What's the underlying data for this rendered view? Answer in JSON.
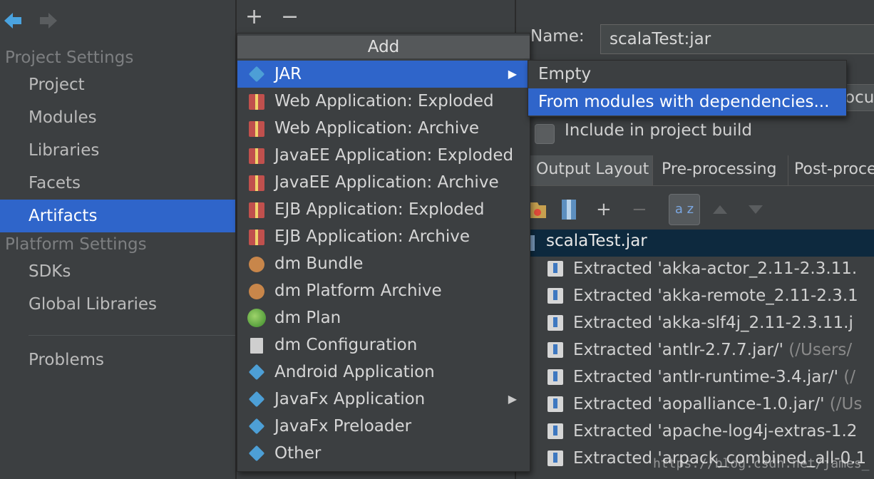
{
  "sidebar": {
    "project_settings_title": "Project Settings",
    "platform_settings_title": "Platform Settings",
    "project_items": [
      "Project",
      "Modules",
      "Libraries",
      "Facets",
      "Artifacts"
    ],
    "platform_items": [
      "SDKs",
      "Global Libraries"
    ],
    "problems": "Problems",
    "selected": "Artifacts"
  },
  "toolbar": {
    "add": "+",
    "remove": "−"
  },
  "add_menu": {
    "title": "Add",
    "items": [
      {
        "label": "JAR",
        "icon": "jar-diamond-icon",
        "submenu": true
      },
      {
        "label": "Web Application: Exploded",
        "icon": "gift-icon"
      },
      {
        "label": "Web Application: Archive",
        "icon": "gift-icon"
      },
      {
        "label": "JavaEE Application: Exploded",
        "icon": "gift-icon"
      },
      {
        "label": "JavaEE Application: Archive",
        "icon": "gift-icon"
      },
      {
        "label": "EJB Application: Exploded",
        "icon": "gift-icon"
      },
      {
        "label": "EJB Application: Archive",
        "icon": "gift-icon"
      },
      {
        "label": "dm Bundle",
        "icon": "bundle-icon"
      },
      {
        "label": "dm Platform Archive",
        "icon": "bundle-icon"
      },
      {
        "label": "dm Plan",
        "icon": "globe-icon"
      },
      {
        "label": "dm Configuration",
        "icon": "document-icon"
      },
      {
        "label": "Android Application",
        "icon": "diamond-icon"
      },
      {
        "label": "JavaFx Application",
        "icon": "diamond-icon",
        "submenu": true
      },
      {
        "label": "JavaFx Preloader",
        "icon": "diamond-icon"
      },
      {
        "label": "Other",
        "icon": "diamond-icon"
      }
    ],
    "submenu_arrow": "▶"
  },
  "jar_submenu": {
    "items": [
      "Empty",
      "From modules with dependencies..."
    ],
    "selected": "From modules with dependencies..."
  },
  "details": {
    "name_label": "Name:",
    "name_value": "scalaTest:jar",
    "location_button": "ocu",
    "include_label": "Include in project build",
    "tabs": [
      "Output Layout",
      "Pre-processing",
      "Post-proce"
    ],
    "active_tab": "Output Layout",
    "tree_root": "scalaTest.jar",
    "rows": [
      {
        "text": "Extracted 'akka-actor_2.11-2.3.11.",
        "dim": ""
      },
      {
        "text": "Extracted 'akka-remote_2.11-2.3.1",
        "dim": ""
      },
      {
        "text": "Extracted 'akka-slf4j_2.11-2.3.11.j",
        "dim": ""
      },
      {
        "text": "Extracted 'antlr-2.7.7.jar/'",
        "dim": " (/Users/"
      },
      {
        "text": "Extracted 'antlr-runtime-3.4.jar/'",
        "dim": " (/"
      },
      {
        "text": "Extracted 'aopalliance-1.0.jar/'",
        "dim": " (/Us"
      },
      {
        "text": "Extracted 'apache-log4j-extras-1.2",
        "dim": ""
      },
      {
        "text": "Extracted 'arpack_combined_all-0.1",
        "dim": ""
      }
    ],
    "tools": {
      "add": "+",
      "remove": "−",
      "sort": "a z"
    }
  },
  "watermark": "https://blog.csdn.net/james_"
}
